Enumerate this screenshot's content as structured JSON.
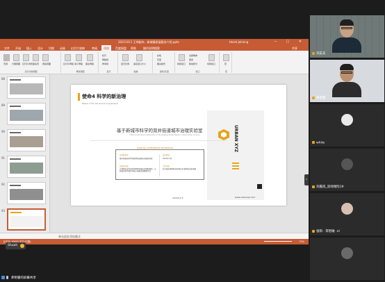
{
  "powerpoint": {
    "title": "20211011 王坤副市、新城镇发展股份介绍.pptx",
    "app": "PowerPoint",
    "user": "Hsieh Jelming",
    "menu": [
      "文件",
      "开始",
      "插入",
      "设计",
      "切换",
      "动画",
      "幻灯片放映",
      "审阅",
      "视图",
      "百度网盘",
      "帮助",
      "操作说明搜索"
    ],
    "active_menu": "视图",
    "share_btn": "共享",
    "ribbon_groups": [
      {
        "label": "演示文稿视图",
        "buttons": [
          "普通",
          "大纲视图",
          "幻灯片浏览",
          "备注页",
          "阅读视图"
        ]
      },
      {
        "label": "母版视图",
        "buttons": [
          "幻灯片母版",
          "讲义母版",
          "备注母版"
        ]
      },
      {
        "label": "显示",
        "buttons": [
          "标尺",
          "网格线",
          "参考线"
        ]
      },
      {
        "label": "缩放",
        "buttons": [
          "显示比例",
          "适应窗口大小"
        ]
      },
      {
        "label": "颜色/灰度",
        "buttons": [
          "彩色",
          "灰度",
          "黑白模式"
        ]
      },
      {
        "label": "窗口",
        "buttons": [
          "新建窗口",
          "全部重排",
          "层叠",
          "移动拆分",
          "切换窗口"
        ]
      },
      {
        "label": "宏",
        "buttons": [
          "宏"
        ]
      }
    ],
    "thumbnails": [
      "88",
      "89",
      "90",
      "91",
      "92",
      "93"
    ],
    "notes_placeholder": "单击此处添加备注",
    "status_left": "幻灯片 93/93   中文(中国)",
    "zoom": "75%",
    "slide": {
      "heading": "使命4 科学的新治理",
      "subheading": "Mission 4 The new science of governance",
      "main_title": "基于新城市科学的双井街道城市治理实验室",
      "main_en": "Urban Governance Laboratory of Shuangjing Street Based on New Urban Science",
      "lab_title": "实验室介绍 | EXPERIMENTAL INFORMATION",
      "lab_name_key": "实验室名称",
      "lab_name_val": "基于新城市科学的双井街道城市治理实验室",
      "lab_time_key": "成立时间",
      "lab_time_val": "2021年7月",
      "lab_desc_key": "实验室介绍",
      "lab_desc_val": "以双井街道为实验场景探索城市治理新模式，以新城市科学理论为核心构建多维数据平台",
      "lab_org_key": "合作单位",
      "lab_org_val": "北京城市象限科技有限公司 双井街道办事处",
      "date": "2020/11/3",
      "brand": "URBAN XYZ",
      "url": "www.urbanxyz.com"
    }
  },
  "meeting": {
    "speaker": "Shuah",
    "share_status": "茅明睿的屏幕共享",
    "participants": [
      {
        "name": "刘志东",
        "video": true
      },
      {
        "name": "茅明睿",
        "video": true
      },
      {
        "name": "white",
        "video": false
      },
      {
        "name": "刘嘉岚_双绿保险19",
        "video": false
      },
      {
        "name": "张阳 · 李智敏 .nl",
        "video": false
      },
      {
        "name": "",
        "video": false
      }
    ]
  }
}
